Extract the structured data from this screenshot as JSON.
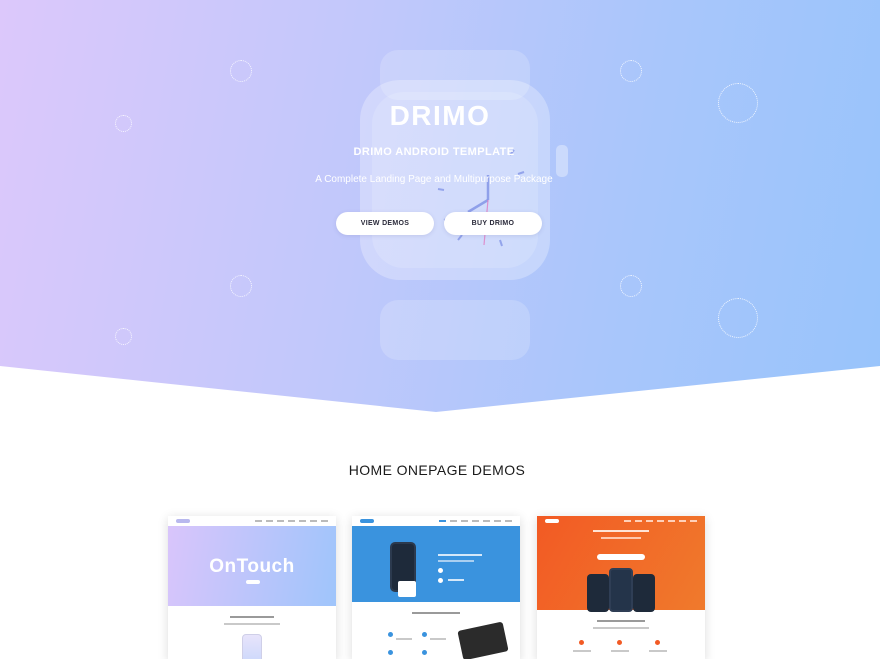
{
  "hero": {
    "title": "DRIMO",
    "subtitle": "DRIMO ANDROID TEMPLATE",
    "description": "A Complete Landing Page and Multipurpose Package",
    "buttons": {
      "view_demos": "VIEW DEMOS",
      "buy": "BUY DRIMO"
    },
    "gradient_start": "#dcc8fb",
    "gradient_end": "#98c4fb"
  },
  "demos": {
    "title": "HOME ONEPAGE DEMOS",
    "cards": [
      {
        "hero_text": "OnTouch",
        "accent": "#b8c6fb"
      },
      {
        "accent": "#3a93de"
      },
      {
        "accent": "#f25a24"
      }
    ]
  }
}
